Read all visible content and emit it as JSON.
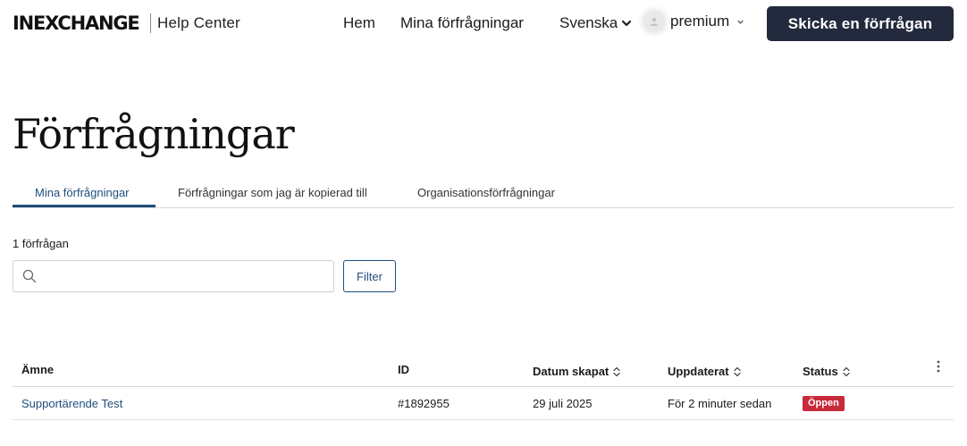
{
  "header": {
    "logo": "INEXCHANGE",
    "help_center": "Help Center",
    "nav_home": "Hem",
    "nav_my_requests": "Mina förfrågningar",
    "language": "Svenska",
    "user_name": "premium",
    "submit_button": "Skicka en förfrågan"
  },
  "page": {
    "title": "Förfrågningar"
  },
  "tabs": [
    {
      "label": "Mina förfrågningar",
      "active": true
    },
    {
      "label": "Förfrågningar som jag är kopierad till",
      "active": false
    },
    {
      "label": "Organisationsförfrågningar",
      "active": false
    }
  ],
  "requests": {
    "count_label": "1 förfrågan",
    "search_value": "",
    "filter_button": "Filter"
  },
  "table": {
    "columns": {
      "subject": "Ämne",
      "id": "ID",
      "created": "Datum skapat",
      "updated": "Uppdaterat",
      "status": "Status"
    },
    "rows": [
      {
        "subject": "Supportärende Test",
        "id": "#1892955",
        "created": "29 juli 2025",
        "updated": "För 2 minuter sedan",
        "status": "Öppen"
      }
    ]
  },
  "colors": {
    "accent": "#1f4e7a",
    "button_dark": "#242a3d",
    "status_open": "#c72a3a"
  }
}
